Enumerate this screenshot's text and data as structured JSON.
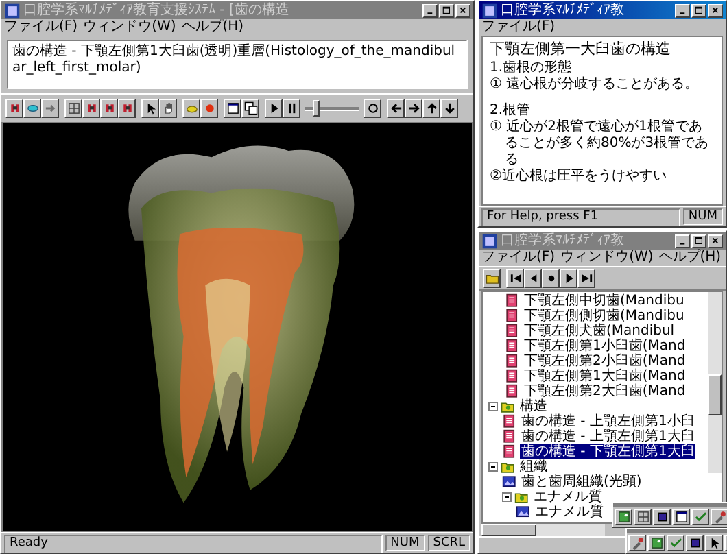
{
  "main_window": {
    "title": "口腔学系ﾏﾙﾁﾒﾃﾞｨｱ教育支援ｼｽﾃﾑ - [歯の構造",
    "active": false,
    "menu": [
      "ファイル(F)",
      "ウィンドウ(W)",
      "ヘルプ(H)"
    ],
    "description": "歯の構造 - 下顎左側第1大臼歯(透明)重層(Histology_of_the_mandibular_left_first_molar)",
    "zoom_slider": {
      "level": 0.2
    },
    "status_bar": [
      "Ready",
      "NUM",
      "SCRL"
    ]
  },
  "narrator_window": {
    "title": "口腔学系ﾏﾙﾁﾒﾃﾞｨｱ教",
    "active": true,
    "menu": [
      "ファイル(F)"
    ],
    "paragraphs": [
      {
        "kind": "title",
        "text": "下顎左側第一大臼歯の構造"
      },
      {
        "kind": "section",
        "text": "1.歯根の形態"
      },
      {
        "kind": "item",
        "text": "① 遠心根が分岐することがある。"
      },
      {
        "kind": "section",
        "text": "2.根管"
      },
      {
        "kind": "item",
        "text": "① 近心が2根管で遠心が1根管であることが多く約80%が3根管である"
      },
      {
        "kind": "item",
        "text": "②近心根は圧平をうけやすい"
      }
    ],
    "status_bar": [
      "For Help, press F1",
      "NUM"
    ]
  },
  "tree_window": {
    "title": "口腔学系ﾏﾙﾁﾒﾃﾞｨｱ教",
    "active": false,
    "menu": [
      "ファイル(F)",
      "ウィンドウ(W)",
      "ヘルプ(H)"
    ],
    "tree": {
      "scrolled_items": [
        {
          "label": "下顎左側中切歯(Mandibu",
          "kind": "page",
          "selected": false
        },
        {
          "label": "下顎左側側切歯(Mandibu",
          "kind": "page",
          "selected": false
        },
        {
          "label": "下顎左側犬歯(Mandibul",
          "kind": "page",
          "selected": false
        },
        {
          "label": "下顎左側第1小臼歯(Mand",
          "kind": "page",
          "selected": false
        },
        {
          "label": "下顎左側第2小臼歯(Mand",
          "kind": "page",
          "selected": false
        },
        {
          "label": "下顎左側第1大臼歯(Mand",
          "kind": "page",
          "selected": false
        },
        {
          "label": "下顎左側第2大臼歯(Mand",
          "kind": "page",
          "selected": false
        }
      ],
      "nodes": [
        {
          "label": "構造",
          "kind": "folder",
          "expanded": true,
          "selected": false,
          "children": [
            {
              "label": "歯の構造 - 上顎左側第1小臼",
              "kind": "page",
              "selected": false
            },
            {
              "label": "歯の構造 - 上顎左側第1大臼",
              "kind": "page",
              "selected": false
            },
            {
              "label": "歯の構造 - 下顎左側第1大臼",
              "kind": "page",
              "selected": true
            }
          ]
        },
        {
          "label": "組織",
          "kind": "folder",
          "expanded": true,
          "selected": false,
          "children": [
            {
              "label": "歯と歯周組織(光顕)",
              "kind": "image",
              "selected": false
            },
            {
              "label": "エナメル質",
              "kind": "folder",
              "expanded": true,
              "selected": false,
              "children": [
                {
                  "label": "エナメル質",
                  "kind": "image",
                  "selected": false
                }
              ]
            }
          ]
        }
      ]
    }
  }
}
